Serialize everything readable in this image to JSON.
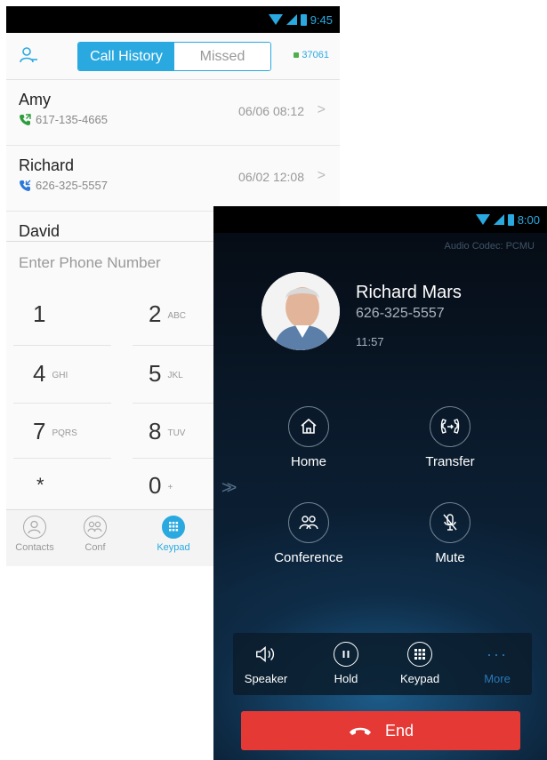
{
  "phone1": {
    "status": {
      "time": "9:45"
    },
    "header": {
      "tabs": [
        {
          "label": "Call History",
          "active": true
        },
        {
          "label": "Missed",
          "active": false
        }
      ],
      "account": "37061"
    },
    "calls": [
      {
        "name": "Amy",
        "number": "617-135-4665",
        "datetime": "06/06  08:12",
        "direction": "outgoing",
        "icon_color": "#2e9e3d"
      },
      {
        "name": "Richard",
        "number": "626-325-5557",
        "datetime": "06/02  12:08",
        "direction": "incoming",
        "icon_color": "#2a78d8"
      },
      {
        "name": "David",
        "number": "",
        "datetime": ""
      }
    ],
    "entry": {
      "placeholder": "Enter Phone Number"
    },
    "keys": [
      {
        "digit": "1",
        "letters": ""
      },
      {
        "digit": "2",
        "letters": "ABC"
      },
      {
        "digit": "4",
        "letters": "GHI"
      },
      {
        "digit": "5",
        "letters": "JKL"
      },
      {
        "digit": "7",
        "letters": "PQRS"
      },
      {
        "digit": "8",
        "letters": "TUV"
      },
      {
        "digit": "*",
        "letters": ""
      },
      {
        "digit": "0",
        "letters": "+"
      }
    ],
    "tabbar": [
      {
        "label": "Contacts",
        "icon": "contacts-icon"
      },
      {
        "label": "Conf",
        "icon": "conference-icon"
      },
      {
        "label": "Keypad",
        "icon": "keypad-icon",
        "active": true
      }
    ],
    "accent": "#2aa9e0"
  },
  "phone2": {
    "status": {
      "time": "8:00"
    },
    "codec": "Audio Codec: PCMU",
    "caller": {
      "name": "Richard Mars",
      "number": "626-325-5557",
      "duration": "11:57"
    },
    "actions": [
      {
        "label": "Home",
        "icon": "home-icon"
      },
      {
        "label": "Transfer",
        "icon": "transfer-icon"
      },
      {
        "label": "Conference",
        "icon": "conference-icon"
      },
      {
        "label": "Mute",
        "icon": "mute-icon"
      }
    ],
    "toolbar": [
      {
        "label": "Speaker",
        "icon": "speaker-icon"
      },
      {
        "label": "Hold",
        "icon": "pause-icon"
      },
      {
        "label": "Keypad",
        "icon": "keypad-icon"
      },
      {
        "label": "More",
        "icon": "more-icon"
      }
    ],
    "end_label": "End",
    "end_color": "#e53935"
  }
}
